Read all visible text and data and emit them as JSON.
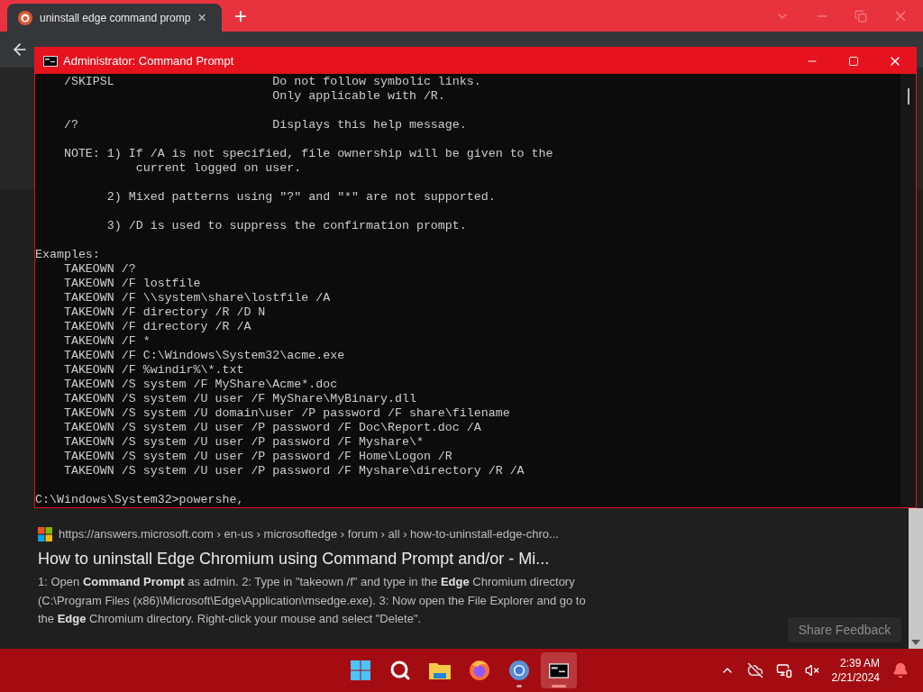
{
  "browser": {
    "tab": {
      "title": "uninstall edge command promp",
      "close": "×"
    },
    "new_tab": "+"
  },
  "console_window": {
    "title": "Administrator: Command Prompt",
    "blocks": [
      [
        "    /SKIPSL                      Do not follow symbolic links.",
        "                                 Only applicable with /R."
      ],
      [
        "    /?                           Displays this help message."
      ],
      [
        "    NOTE: 1) If /A is not specified, file ownership will be given to the",
        "              current logged on user."
      ],
      [
        "          2) Mixed patterns using \"?\" and \"*\" are not supported."
      ],
      [
        "          3) /D is used to suppress the confirmation prompt."
      ],
      [
        "Examples:",
        "    TAKEOWN /?",
        "    TAKEOWN /F lostfile",
        "    TAKEOWN /F \\\\system\\share\\lostfile /A",
        "    TAKEOWN /F directory /R /D N",
        "    TAKEOWN /F directory /R /A",
        "    TAKEOWN /F *",
        "    TAKEOWN /F C:\\Windows\\System32\\acme.exe",
        "    TAKEOWN /F %windir%\\*.txt",
        "    TAKEOWN /S system /F MyShare\\Acme*.doc",
        "    TAKEOWN /S system /U user /F MyShare\\MyBinary.dll",
        "    TAKEOWN /S system /U domain\\user /P password /F share\\filename",
        "    TAKEOWN /S system /U user /P password /F Doc\\Report.doc /A",
        "    TAKEOWN /S system /U user /P password /F Myshare\\*",
        "    TAKEOWN /S system /U user /P password /F Home\\Logon /R",
        "    TAKEOWN /S system /U user /P password /F Myshare\\directory /R /A"
      ],
      [
        "C:\\Windows\\System32>powershe,"
      ]
    ]
  },
  "search_result": {
    "url": "https://answers.microsoft.com › en-us › microsoftedge › forum › all › how-to-uninstall-edge-chro...",
    "title": "How to uninstall Edge Chromium using Command Prompt and/or - Mi...",
    "snippet": "1: Open **Command Prompt** as admin. 2: Type in \"takeown /f\" and type in the **Edge** Chromium directory (C:\\Program Files (x86)\\Microsoft\\Edge\\Application\\msedge.exe). 3: Now open the File Explorer and go to the **Edge** Chromium directory. Right-click your mouse and select \"Delete\"."
  },
  "share_feedback": "Share Feedback",
  "taskbar": {
    "apps": [
      {
        "kind": "start",
        "running": false,
        "selected": false
      },
      {
        "kind": "search",
        "running": false,
        "selected": false
      },
      {
        "kind": "folder",
        "running": false,
        "selected": false
      },
      {
        "kind": "firefox",
        "running": false,
        "selected": false
      },
      {
        "kind": "chrome",
        "running": true,
        "selected": false
      },
      {
        "kind": "terminal",
        "running": true,
        "selected": true
      }
    ],
    "time": "2:39 AM",
    "date": "2/21/2024"
  }
}
